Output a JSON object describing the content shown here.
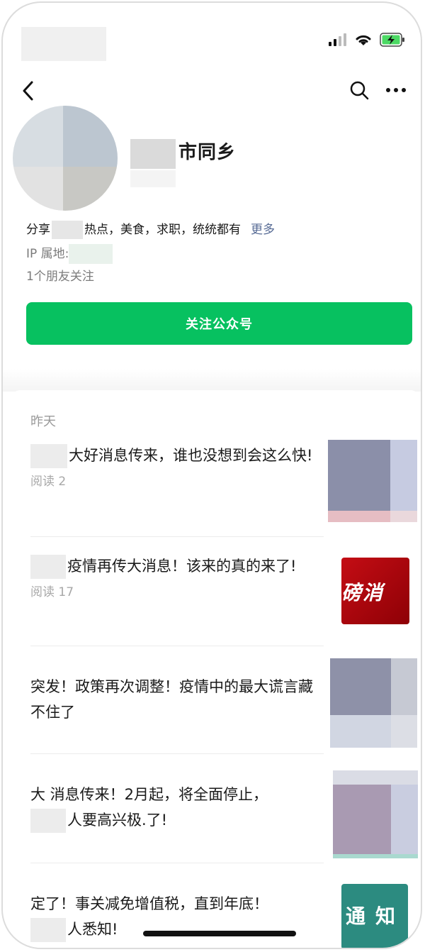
{
  "nav": {
    "back_icon": "chevron-left-icon",
    "search_icon": "search-icon",
    "more_icon": "more-horizontal-icon"
  },
  "status": {
    "icons": [
      "signal-icon",
      "wifi-icon",
      "battery-charging-icon"
    ],
    "battery_color": "#4cd964"
  },
  "profile": {
    "name": "市同乡",
    "desc_part1": "分享",
    "desc_part2": "热点，美食，求职，统统都有",
    "more_label": "更多",
    "ip_label": "IP 属地:",
    "friends_text": "1个朋友关注",
    "follow_button": "关注公众号"
  },
  "feed": {
    "section_date": "昨天",
    "articles": [
      {
        "title": "大好消息传来，谁也没想到会这么快!",
        "reads": "阅读 2"
      },
      {
        "title": "疫情再传大消息！该来的真的来了!",
        "reads": "阅读 17"
      },
      {
        "title": "突发！政策再次调整！疫情中的最大谎言藏不住了",
        "reads": ""
      },
      {
        "title_line1": "大 消息传来！2月起，将全面停止，",
        "title_line2": "人要高兴极.了!",
        "reads": ""
      },
      {
        "title_line1": "定了！事关减免增值税，直到年底！",
        "title_line2": "人悉知!",
        "reads": ""
      }
    ],
    "thumb2_text": "磅消",
    "thumb5_text": "通知"
  },
  "colors": {
    "accent_green": "#07c160",
    "link_blue": "#576b95"
  }
}
